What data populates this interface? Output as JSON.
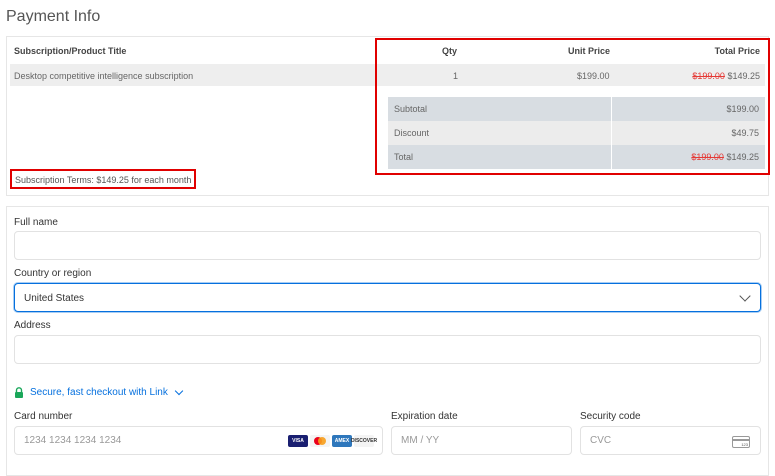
{
  "page": {
    "title": "Payment Info"
  },
  "summary": {
    "headers": {
      "title": "Subscription/Product Title",
      "qty": "Qty",
      "unit_price": "Unit Price",
      "total_price": "Total Price"
    },
    "item": {
      "title": "Desktop competitive intelligence subscription",
      "qty": "1",
      "unit_price": "$199.00",
      "total_old": "$199.00",
      "total_new": "$149.25"
    },
    "subtotal": {
      "label": "Subtotal",
      "value": "$199.00"
    },
    "discount": {
      "label": "Discount",
      "value": "$49.75"
    },
    "total": {
      "label": "Total",
      "old": "$199.00",
      "new": "$149.25"
    },
    "terms": "Subscription Terms: $149.25 for each month"
  },
  "form": {
    "full_name": {
      "label": "Full name",
      "value": ""
    },
    "country": {
      "label": "Country or region",
      "value": "United States"
    },
    "address": {
      "label": "Address",
      "value": ""
    },
    "link": {
      "text": "Secure, fast checkout with Link"
    },
    "card_number": {
      "label": "Card number",
      "placeholder": "1234 1234 1234 1234"
    },
    "expiration": {
      "label": "Expiration date",
      "placeholder": "MM / YY"
    },
    "security": {
      "label": "Security code",
      "placeholder": "CVC",
      "icon_text": "123"
    },
    "brands": [
      "VISA",
      "MC",
      "AMEX",
      "DISCOVER"
    ]
  },
  "colors": {
    "accent": "#0570de",
    "highlight": "#e00000",
    "strike": "#e53935"
  }
}
